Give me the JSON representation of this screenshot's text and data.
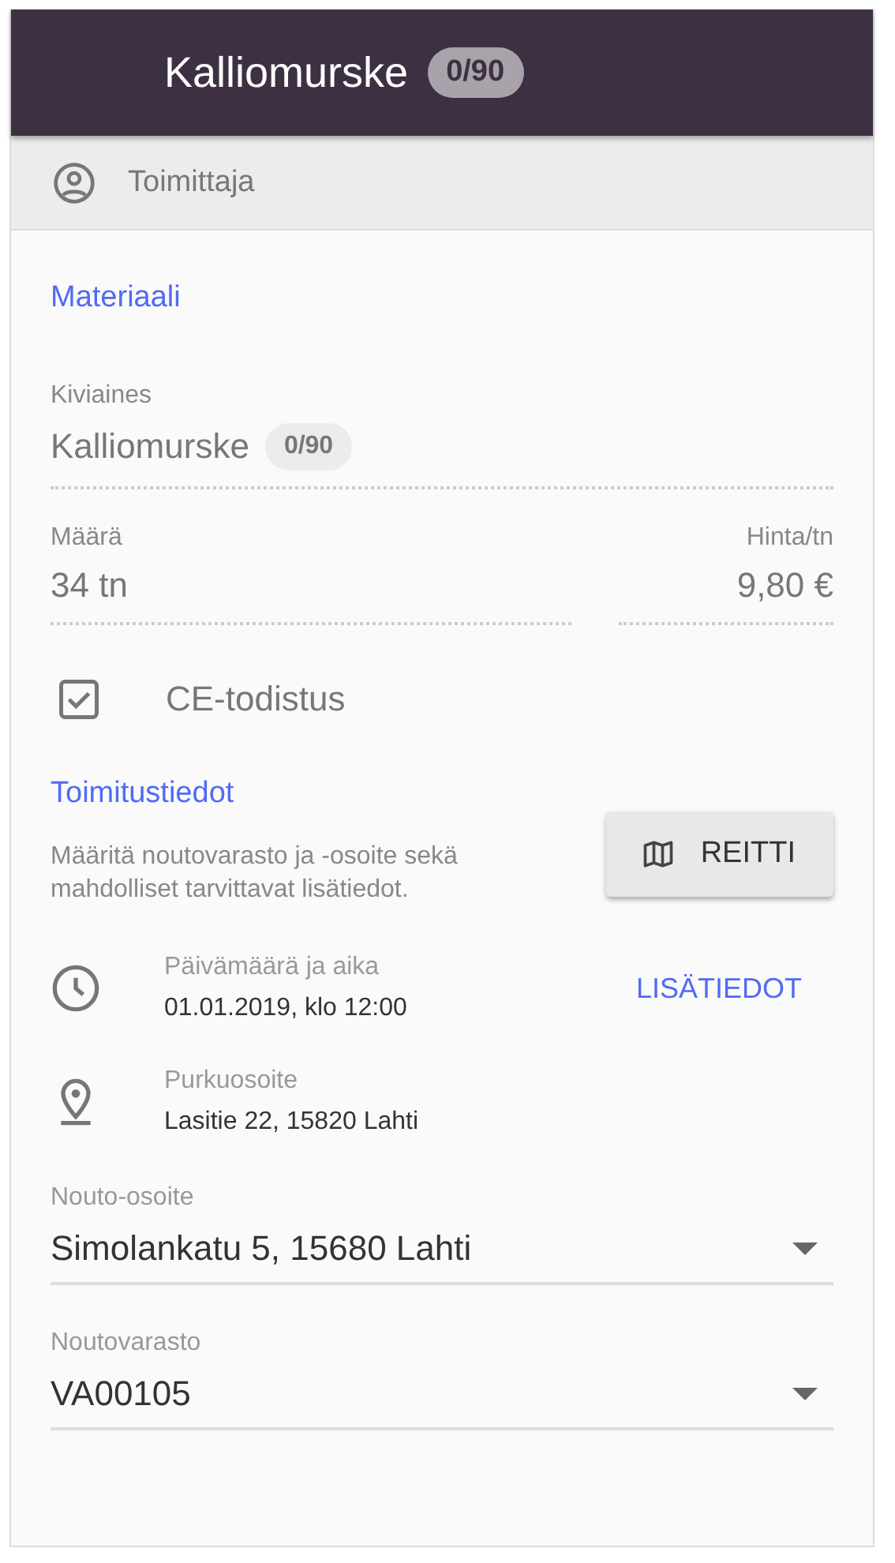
{
  "header": {
    "title": "Kalliomurske",
    "badge": "0/90"
  },
  "supplier": {
    "label": "Toimittaja"
  },
  "material": {
    "heading": "Materiaali",
    "aggregate": {
      "label": "Kiviaines",
      "value": "Kalliomurske",
      "badge": "0/90"
    },
    "quantity": {
      "label": "Määrä",
      "value": "34 tn"
    },
    "price": {
      "label": "Hinta/tn",
      "value": "9,80 €"
    },
    "certificate": {
      "label": "CE-todistus",
      "checked": true
    }
  },
  "delivery": {
    "heading": "Toimitustiedot",
    "description": "Määritä noutovarasto ja -osoite sekä mahdolliset tarvittavat lisätiedot.",
    "route_button": "REITTI",
    "details": [
      {
        "kind": "clock",
        "label": "Päivämäärä ja aika",
        "value": "01.01.2019, klo 12:00",
        "action": "LISÄTIEDOT"
      },
      {
        "kind": "pin",
        "label": "Purkuosoite",
        "value": "Lasitie 22, 15820 Lahti"
      }
    ],
    "selects": [
      {
        "label": "Nouto-osoite",
        "value": "Simolankatu 5, 15680 Lahti"
      },
      {
        "label": "Noutovarasto",
        "value": "VA00105"
      }
    ]
  }
}
